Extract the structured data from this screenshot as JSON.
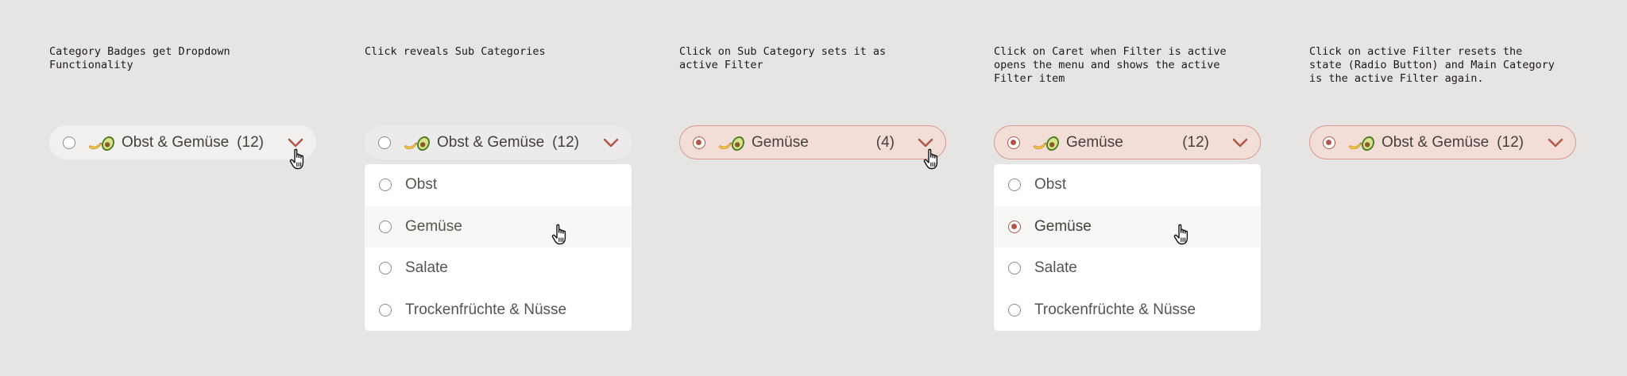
{
  "colors": {
    "background": "#e7e5e4",
    "badge_default": "#f1f0ef",
    "badge_active_bg": "#f3ddd7",
    "badge_active_border": "#d89a8c",
    "accent": "#b4574a",
    "text": "#44403c"
  },
  "icons": {
    "emoji": "banana-avocado-emoji",
    "caret": "chevron-down-icon",
    "cursor": "hand-pointer-cursor"
  },
  "steps": [
    {
      "caption": "Category Badges get Dropdown\nFunctionality",
      "badge": {
        "label": "Obst & Gemüse",
        "count": "(12)",
        "state": "default"
      }
    },
    {
      "caption": "Click reveals Sub Categories",
      "badge": {
        "label": "Obst & Gemüse",
        "count": "(12)",
        "state": "open"
      },
      "menu": [
        {
          "label": "Obst",
          "selected": false
        },
        {
          "label": "Gemüse",
          "selected": false,
          "hover": true
        },
        {
          "label": "Salate",
          "selected": false
        },
        {
          "label": "Trockenfrüchte & Nüsse",
          "selected": false
        }
      ]
    },
    {
      "caption": "Click on Sub Category sets it as\nactive Filter",
      "badge": {
        "label": "Gemüse",
        "count": "(4)",
        "state": "active"
      }
    },
    {
      "caption": "Click on Caret when Filter is active\nopens the menu and shows the active\nFilter item",
      "badge": {
        "label": "Gemüse",
        "count": "(12)",
        "state": "active"
      },
      "menu": [
        {
          "label": "Obst",
          "selected": false
        },
        {
          "label": "Gemüse",
          "selected": true,
          "hover": true
        },
        {
          "label": "Salate",
          "selected": false
        },
        {
          "label": "Trockenfrüchte & Nüsse",
          "selected": false
        }
      ]
    },
    {
      "caption": "Click on active Filter resets the\nstate (Radio Button) and Main Category\nis the active Filter again.",
      "badge": {
        "label": "Obst & Gemüse",
        "count": "(12)",
        "state": "active"
      }
    }
  ]
}
